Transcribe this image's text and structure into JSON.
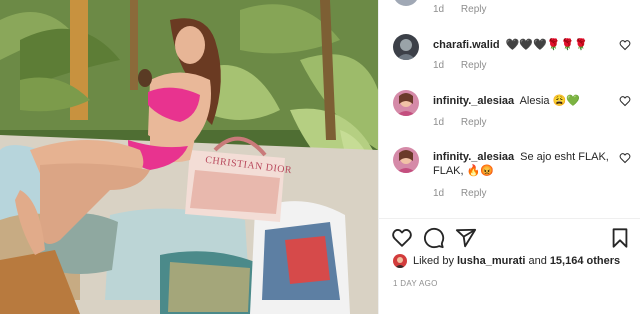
{
  "comments": [
    {
      "username": "",
      "text": "",
      "time": "1d",
      "reply_label": "Reply"
    },
    {
      "username": "charafi.walid",
      "text": "🖤🖤🖤🌹🌹🌹",
      "time": "1d",
      "reply_label": "Reply"
    },
    {
      "username": "infinity._alesiaa",
      "text": "Alesia 😩💚",
      "time": "1d",
      "reply_label": "Reply"
    },
    {
      "username": "infinity._alesiaa",
      "text": "Se ajo esht FLAK, FLAK, 🔥😡",
      "time": "1d",
      "reply_label": "Reply"
    }
  ],
  "likes": {
    "prefix": "Liked by",
    "liker": "lusha_murati",
    "connector": "and",
    "count": "15,164 others"
  },
  "post_date": "1 DAY AGO",
  "photo": {
    "bag_label": "CHRISTIAN DIOR"
  },
  "icons": {
    "like": "heart-icon",
    "comment": "comment-icon",
    "share": "share-icon",
    "save": "bookmark-icon",
    "comment_like": "heart-icon"
  },
  "colors": {
    "text": "#262626",
    "muted": "#8e8e8e",
    "divider": "#efefef",
    "bikini": "#e8338f"
  }
}
